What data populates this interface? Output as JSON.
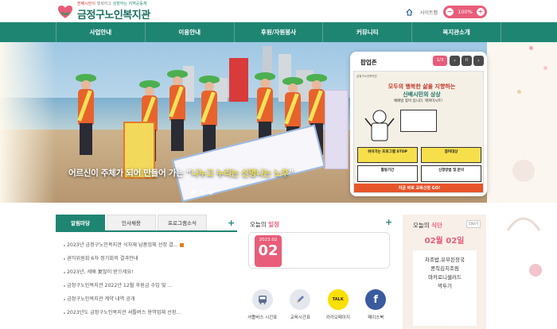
{
  "header": {
    "tagline_red": "한배시민이",
    "tagline_gray": "행복하고",
    "tagline_green": "성장하는 지역공동체",
    "site_title": "금정구노인복지관",
    "sitemap_label": "사이트맵",
    "zoom_minus": "−",
    "zoom_value": "100%",
    "zoom_plus": "+"
  },
  "nav": {
    "items": [
      "사업안내",
      "이용안내",
      "후원/자원봉사",
      "커뮤니티",
      "복지관소개"
    ]
  },
  "hero": {
    "caption_pre": "어르신이 주체가 되어 만들어 가는 “",
    "caption_highlight": "나누고 누리는 신명나는 노후",
    "caption_post": "”",
    "slide_count": 3,
    "active_slide": 1
  },
  "popup": {
    "title": "팝업존",
    "counter": "1/3",
    "prev": "‹",
    "pause": "II",
    "next": "›",
    "poster_top": "금정구노인복지관",
    "poster_heading_red": "모두의 행복한 삶을 지향하는",
    "poster_heading_green": "신배시민의 상상",
    "poster_sub": "예배밥 찾아 입니다. 헤쳐미시트!",
    "box1_title": "쉬어가는 프로그램 STOP",
    "box2_title": "참여대상",
    "box3_title": "활동기간",
    "box4_title": "신청방법 및 문의",
    "foot": "지금 바로 교육신청 GO!"
  },
  "notice": {
    "tabs": [
      "알림마당",
      "인사채용",
      "프로그램소식"
    ],
    "active_tab": 0,
    "more": "+",
    "items": [
      {
        "text": "2023년 금정구노인복지관 식자재 납품업체 선정 결...",
        "new": true
      },
      {
        "text": "권익위원회 6차 정기회의 결과안내",
        "new": false
      },
      {
        "text": "2023년, 세배 复많이 받으세요!",
        "new": false
      },
      {
        "text": "금정구노인복지관 2022년 12월 후원금 수입 및 ...",
        "new": false
      },
      {
        "text": "금정구노인복지관 계약 내역 공개",
        "new": false
      },
      {
        "text": "2023년도 금정구노인복지관 셔틀버스 용역업체 선정...",
        "new": false
      }
    ]
  },
  "schedule": {
    "title_pre": "오늘의 ",
    "title_em": "일정",
    "more": "+",
    "year_month": "2023.02",
    "day": "02",
    "quick_links": [
      {
        "label": "셔틀버스 시간표",
        "icon": "bus-icon",
        "color": "#7f8fa6",
        "glyph": "🚌"
      },
      {
        "label": "교육시간표",
        "icon": "pencil-icon",
        "color": "#8a9cc0",
        "glyph": "✎"
      },
      {
        "label": "카카오페이지",
        "icon": "kakao-talk-icon",
        "color": "#f9e000",
        "glyph": "TALK"
      },
      {
        "label": "페이스북",
        "icon": "facebook-icon",
        "color": "#3b5b9f",
        "glyph": "f"
      }
    ]
  },
  "menu": {
    "title_pre": "오늘의 ",
    "title_em": "식단",
    "more": "더보기",
    "date": "02월 02일",
    "items": [
      "차조밥,유부된장국",
      "콩칙김치조림",
      "마카로니샐러드",
      "깍두기"
    ]
  },
  "colors": {
    "primary": "#1f8573",
    "accent": "#e85d7a"
  }
}
